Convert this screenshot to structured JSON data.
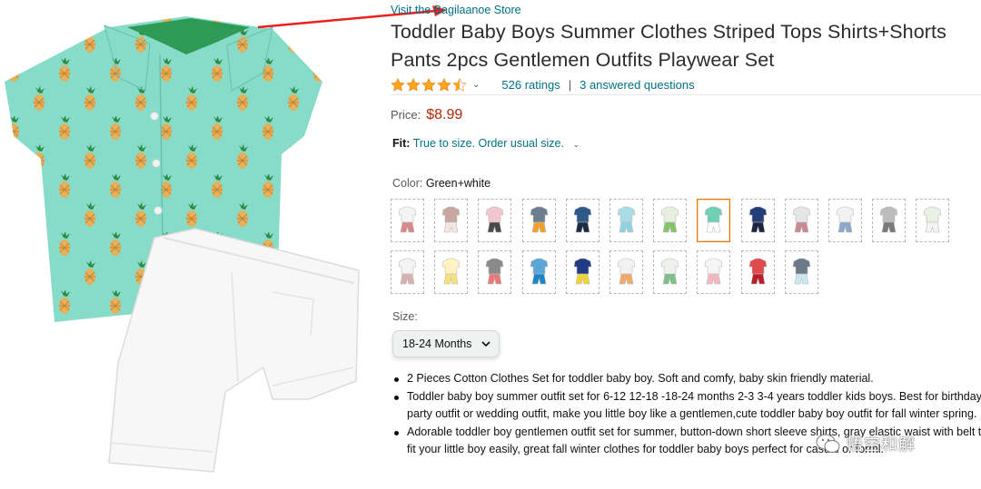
{
  "store": {
    "link_text": "Visit the Bagilaanoe Store"
  },
  "product": {
    "title": "Toddler Baby Boys Summer Clothes Striped Tops Shirts+Shorts Pants 2pcs Gentlemen Outfits Playwear Set",
    "rating_stars": 4.5,
    "ratings_text": "526 ratings",
    "separator": "|",
    "answered_text": "3 answered questions",
    "price_label": "Price:",
    "price_value": "$8.99",
    "fit_label": "Fit:",
    "fit_value": "True to size. Order usual size.",
    "color_label": "Color:",
    "color_value": "Green+white",
    "size_label": "Size:",
    "size_value": "18-24 Months",
    "bullets": [
      "2 Pieces Cotton Clothes Set for toddler baby boy. Soft and comfy, baby skin friendly material.",
      "Toddler baby boy summer outfit set for 6-12 12-18 -18-24 months 2-3 3-4 years toddler kids boys. Best for birthday party outfit or wedding outfit, make you little boy like a gentlemen,cute toddler baby boy outfit for fall winter spring.",
      "Adorable toddler boy gentlemen outfit set for summer, button-down short sleeve shirts, gray elastic waist with belt to fit your little boy easily, great fall winter clothes for toddler baby boys perfect for casual or forml."
    ]
  },
  "swatches": [
    {
      "shirt": "#f4f4f4",
      "shorts": "#d88a8a"
    },
    {
      "shirt": "#c9a7a0",
      "shorts": "#f2e6e0"
    },
    {
      "shirt": "#f1c6d0",
      "shorts": "#4a4a4a"
    },
    {
      "shirt": "#6d7f8f",
      "shorts": "#f0a12b"
    },
    {
      "shirt": "#2e5a8a",
      "shorts": "#1d2b44"
    },
    {
      "shirt": "#a9dce6",
      "shorts": "#8fd3e0"
    },
    {
      "shirt": "#e8efe0",
      "shorts": "#86c46b"
    },
    {
      "shirt": "#6fd0b5",
      "shorts": "#ffffff"
    },
    {
      "shirt": "#243e7a",
      "shorts": "#1c2540"
    },
    {
      "shirt": "#e6e6e6",
      "shorts": "#c98a94"
    },
    {
      "shirt": "#f2f2f2",
      "shorts": "#8da8c8"
    },
    {
      "shirt": "#bcbcbc",
      "shorts": "#7a7a7a"
    },
    {
      "shirt": "#e9f0e4",
      "shorts": "#f3f3f3"
    },
    {
      "shirt": "#f3f3f3",
      "shorts": "#d9b0b0"
    },
    {
      "shirt": "#fff3c4",
      "shorts": "#f5e27a"
    },
    {
      "shirt": "#8a8a8a",
      "shorts": "#e87a7a"
    },
    {
      "shirt": "#5aa6d6",
      "shorts": "#1e86c4"
    },
    {
      "shirt": "#213a86",
      "shorts": "#f2d23a"
    },
    {
      "shirt": "#f2f2f2",
      "shorts": "#f0a96a"
    },
    {
      "shirt": "#eef2ec",
      "shorts": "#7fbf8a"
    },
    {
      "shirt": "#f5f5f5",
      "shorts": "#f4b7c0"
    },
    {
      "shirt": "#e04a4a",
      "shorts": "#b81f2a"
    },
    {
      "shirt": "#6b7a86",
      "shorts": "#c9e8f0"
    }
  ],
  "selected_swatch": 7,
  "colors": {
    "link": "#007185",
    "price": "#b12704",
    "star": "#ffa41c",
    "shirt_teal": "#7fdcc8",
    "arrow": "#e8211f"
  },
  "icons": {
    "rating_caret": "chevron-down-icon",
    "fit_caret": "chevron-down-icon",
    "size_chevron": "chevron-down-icon"
  }
}
